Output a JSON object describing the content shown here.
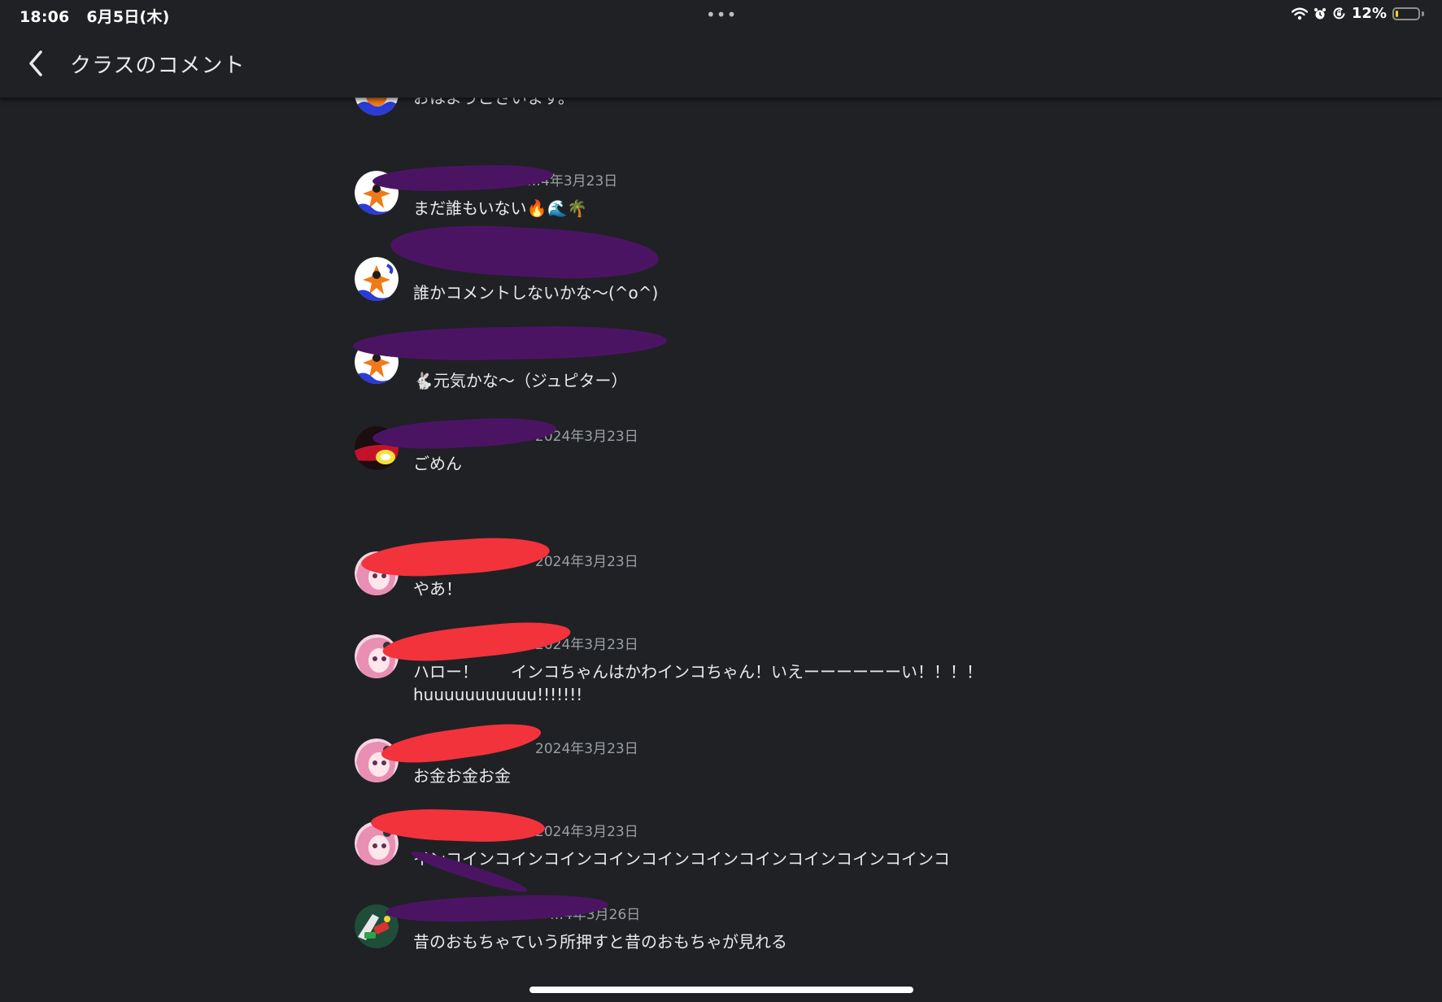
{
  "status_bar": {
    "time": "18:06",
    "date": "6月5日(木)",
    "dots": "•••",
    "battery_percent": "12%",
    "battery_level": 0.12,
    "icons": [
      "wifi-icon",
      "alarm-icon",
      "rotation-lock-icon",
      "battery-icon"
    ]
  },
  "header": {
    "back_icon": "chevron-left-icon",
    "title": "クラスのコメント"
  },
  "comments": [
    {
      "author": "",
      "date": "",
      "text": "おはようございます。",
      "avatar": "orange-character-avatar"
    },
    {
      "author": "",
      "date": "2024年3月23日",
      "date_visible": "…4年3月23日",
      "text": "まだ誰もいない🔥🌊🌴",
      "avatar": "orange-character-avatar"
    },
    {
      "author": "",
      "date": "",
      "text": "誰かコメントしないかな〜(^o^)",
      "avatar": "orange-character-avatar"
    },
    {
      "author": "",
      "date": "",
      "text": "🐇元気かな〜（ジュピター）",
      "avatar": "orange-character-avatar"
    },
    {
      "author": "",
      "date": "2024年3月23日",
      "text": "ごめん",
      "avatar": "red-yellow-avatar"
    },
    {
      "author": "",
      "date": "2024年3月23日",
      "text": "やあ！",
      "avatar": "pink-hair-avatar"
    },
    {
      "author": "",
      "date": "2024年3月23日",
      "text": "ハロー！　　インコちゃんはかわインコちゃん！いえーーーーーーい！！！！\nhuuuuuuuuuuu!!!!!!!",
      "avatar": "pink-hair-avatar"
    },
    {
      "author": "",
      "date": "2024年3月23日",
      "text": "お金お金お金",
      "avatar": "pink-hair-avatar"
    },
    {
      "author": "",
      "date": "2024年3月23日",
      "text": "インコインコインコインコインコインコインコインコインコインコインコ",
      "avatar": "pink-hair-avatar"
    },
    {
      "author": "",
      "date": "2024年3月26日",
      "date_visible": "…4年3月26日",
      "text": "昔のおもちゃていう所押すと昔のおもちゃが見れる",
      "avatar": "racing-game-avatar"
    }
  ],
  "colors": {
    "background": "#202124",
    "text": "#e8eaed",
    "meta": "#9aa0a6",
    "redaction_purple": "#4b1463",
    "redaction_red": "#f2333c"
  }
}
